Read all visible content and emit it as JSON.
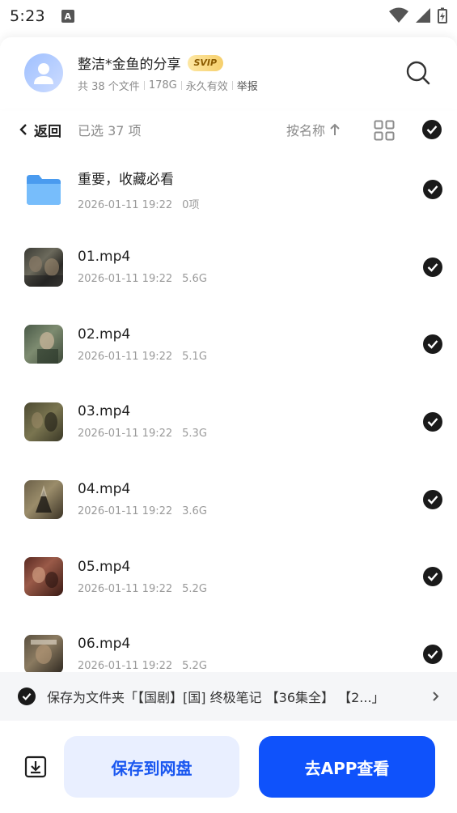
{
  "status_bar": {
    "time": "5:23",
    "notif_letter": "A"
  },
  "share": {
    "title": "整洁*金鱼的分享",
    "badge": "SVIP",
    "file_count": "共 38 个文件",
    "size": "178G",
    "validity": "永久有效",
    "report": "举报"
  },
  "toolbar": {
    "back_label": "返回",
    "selected_label": "已选 37 项",
    "sort_label": "按名称"
  },
  "files": [
    {
      "name": "重要，收藏必看",
      "date": "2026-01-11 19:22",
      "size": "0项",
      "type": "folder"
    },
    {
      "name": "01.mp4",
      "date": "2026-01-11 19:22",
      "size": "5.6G",
      "type": "video"
    },
    {
      "name": "02.mp4",
      "date": "2026-01-11 19:22",
      "size": "5.1G",
      "type": "video"
    },
    {
      "name": "03.mp4",
      "date": "2026-01-11 19:22",
      "size": "5.3G",
      "type": "video"
    },
    {
      "name": "04.mp4",
      "date": "2026-01-11 19:22",
      "size": "3.6G",
      "type": "video"
    },
    {
      "name": "05.mp4",
      "date": "2026-01-11 19:22",
      "size": "5.2G",
      "type": "video"
    },
    {
      "name": "06.mp4",
      "date": "2026-01-11 19:22",
      "size": "5.2G",
      "type": "video"
    }
  ],
  "save_path": {
    "text": "保存为文件夹「【国剧】[国] 终极笔记 【36集全】 【2...」"
  },
  "bottom": {
    "save_button": "保存到网盘",
    "app_button": "去APP查看"
  },
  "colors": {
    "accent": "#0f52fb",
    "accent_light": "#e9efff",
    "check": "#1a1a1a",
    "folder": "#5aa9f5"
  }
}
